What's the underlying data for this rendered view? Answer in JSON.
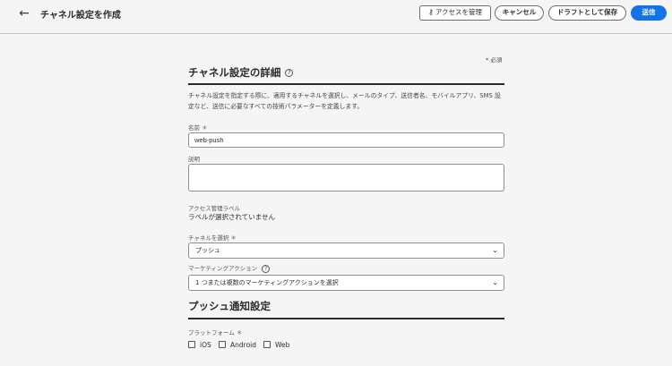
{
  "header": {
    "title": "チャネル設定を作成",
    "back_icon": "arrow-left-icon",
    "manage_access_label": "アクセスを管理",
    "cancel_label": "キャンセル",
    "save_draft_label": "ドラフトとして保存",
    "send_label": "送信",
    "accent_color": "#1473e6"
  },
  "form": {
    "required_note": "* 必須",
    "details": {
      "title": "チャネル設定の詳細",
      "description": "チャネル設定を指定する際に、適用するチャネルを選択し、メールのタイプ、送信者名、モバイルアプリ、SMS 設定など、送信に必要なすべての技術パラメーターを定義します。"
    },
    "name": {
      "label": "名前 ＊",
      "value": "web-push"
    },
    "description_field": {
      "label": "説明",
      "value": ""
    },
    "access_label": {
      "label": "アクセス管理ラベル",
      "value": "ラベルが選択されていません"
    },
    "channel": {
      "label": "チャネルを選択 ＊",
      "value": "プッシュ"
    },
    "marketing_action": {
      "label": "マーケティングアクション",
      "value": "1 つまたは複数のマーケティングアクションを選択"
    },
    "push": {
      "title": "プッシュ通知設定",
      "platform_label": "プラットフォーム ＊",
      "platforms": [
        {
          "label": "iOS",
          "checked": false
        },
        {
          "label": "Android",
          "checked": false
        },
        {
          "label": "Web",
          "checked": false
        }
      ]
    }
  }
}
